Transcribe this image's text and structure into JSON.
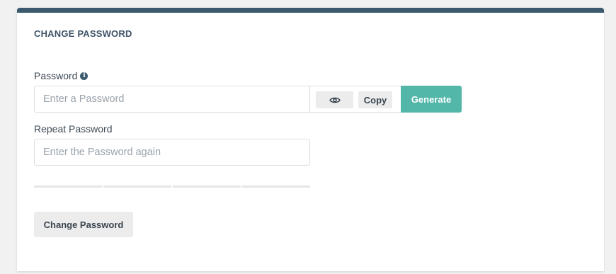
{
  "card": {
    "title": "CHANGE PASSWORD"
  },
  "password": {
    "label": "Password",
    "info_icon": "info-circle-icon",
    "placeholder": "Enter a Password",
    "value": "",
    "toggle_icon": "eye-icon",
    "copy_label": "Copy",
    "generate_label": "Generate"
  },
  "repeat": {
    "label": "Repeat Password",
    "placeholder": "Enter the Password again",
    "value": ""
  },
  "strength_meter": {
    "segments": 4,
    "filled": 0
  },
  "actions": {
    "change_label": "Change Password"
  },
  "colors": {
    "header_bar": "#3b5a6e",
    "generate_bg": "#52b6a8",
    "neutral_btn": "#ececec"
  }
}
